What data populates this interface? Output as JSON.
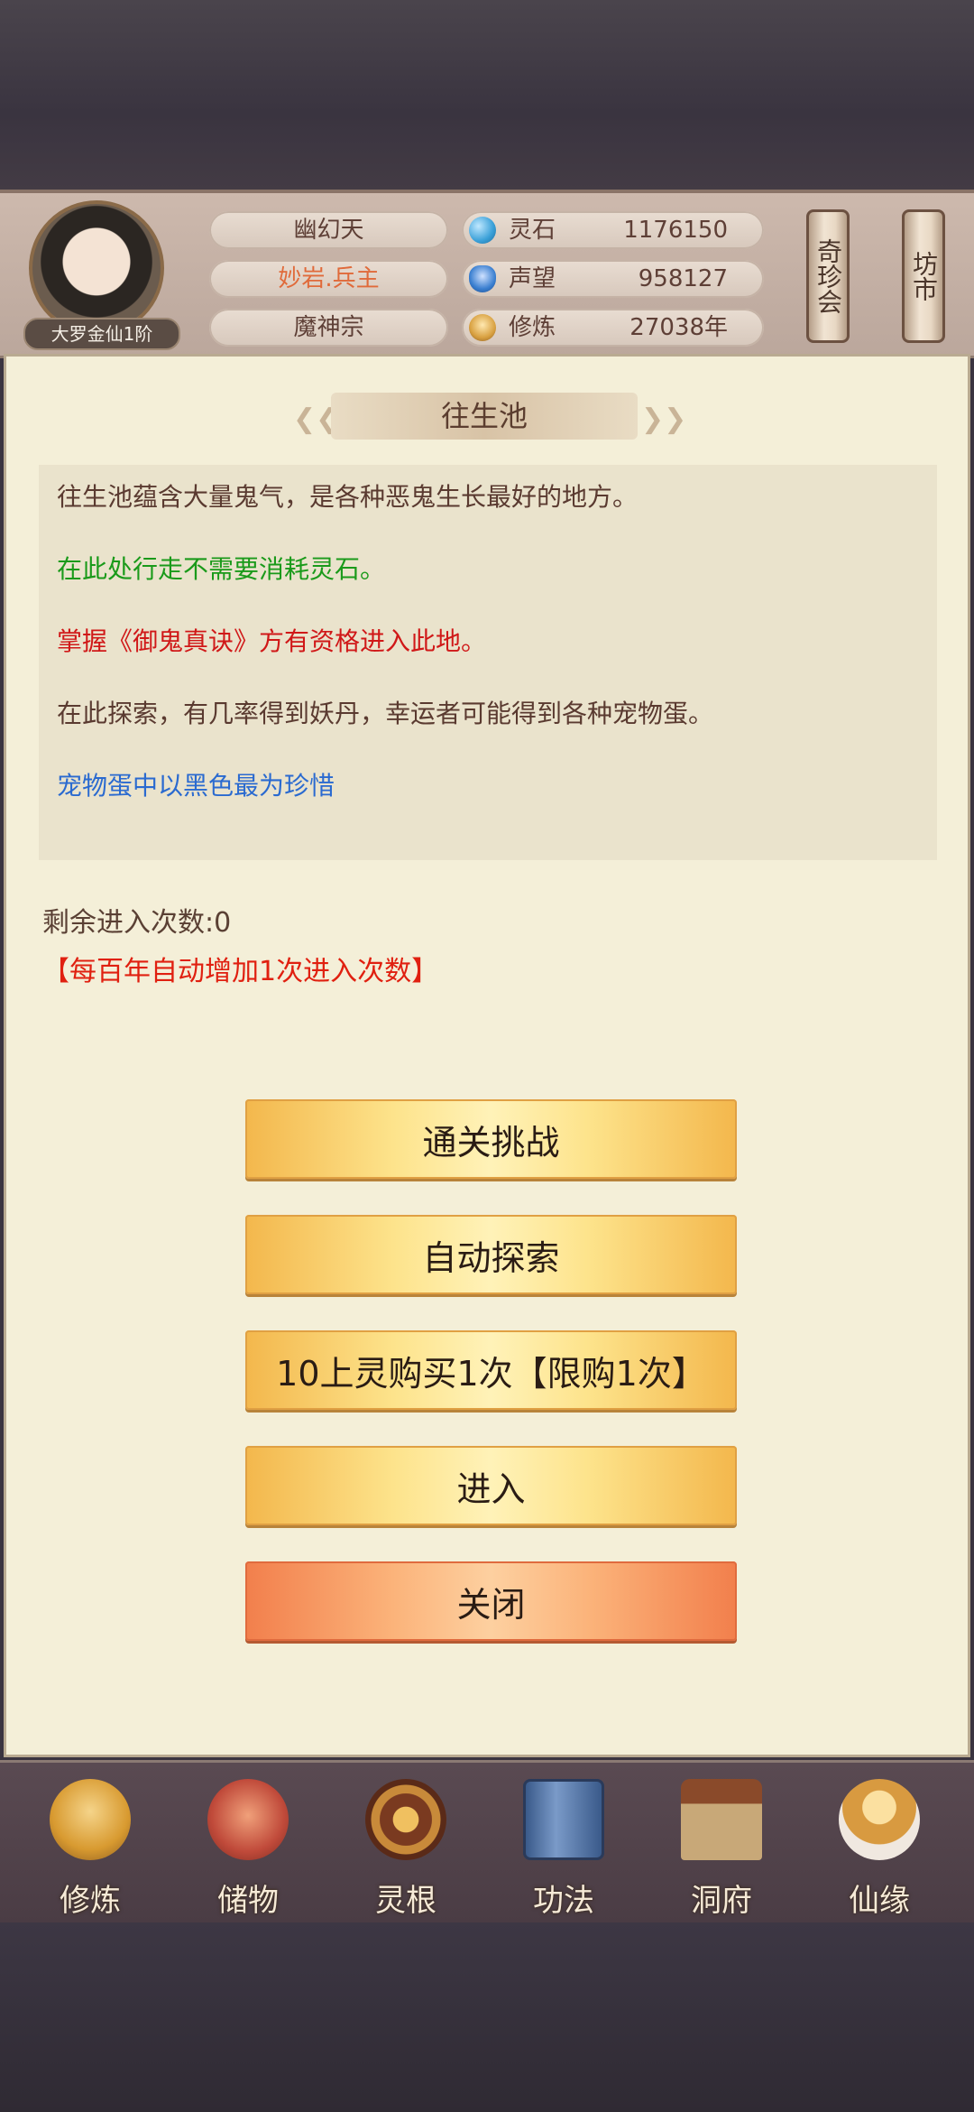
{
  "header": {
    "rank": "大罗金仙1阶",
    "info": [
      "幽幻天",
      "妙岩.兵主",
      "魔神宗"
    ],
    "stats": [
      {
        "label": "灵石",
        "value": "1176150",
        "icon": "spirit-stone-icon",
        "color": "#3aa0d8"
      },
      {
        "label": "声望",
        "value": "958127",
        "icon": "prestige-icon",
        "color": "#3a7fd0"
      },
      {
        "label": "修炼",
        "value": "27038年",
        "icon": "cultivation-icon",
        "color": "#d8a040"
      }
    ],
    "scroll_buttons": [
      "奇珍会",
      "坊市"
    ]
  },
  "panel": {
    "title": "往生池",
    "descriptions": [
      {
        "text": "往生池蕴含大量鬼气，是各种恶鬼生长最好的地方。",
        "color": "#5a3a30"
      },
      {
        "text": "在此处行走不需要消耗灵石。",
        "color": "#1a9a1a"
      },
      {
        "text": "掌握《御鬼真诀》方有资格进入此地。",
        "color": "#d01818"
      },
      {
        "text": "在此探索，有几率得到妖丹，幸运者可能得到各种宠物蛋。",
        "color": "#5a3a30"
      },
      {
        "text": "宠物蛋中以黑色最为珍惜",
        "color": "#2a6ad0"
      }
    ],
    "remaining": "剩余进入次数:0",
    "auto_note": "【每百年自动增加1次进入次数】"
  },
  "buttons": [
    "通关挑战",
    "自动探索",
    "10上灵购买1次【限购1次】",
    "进入",
    "关闭"
  ],
  "nav": [
    {
      "label": "修炼",
      "icon": "meditating-monk-icon"
    },
    {
      "label": "储物",
      "icon": "treasure-bag-icon"
    },
    {
      "label": "灵根",
      "icon": "spirit-root-icon"
    },
    {
      "label": "功法",
      "icon": "book-icon"
    },
    {
      "label": "洞府",
      "icon": "pavilion-icon"
    },
    {
      "label": "仙缘",
      "icon": "gourd-icon"
    }
  ]
}
